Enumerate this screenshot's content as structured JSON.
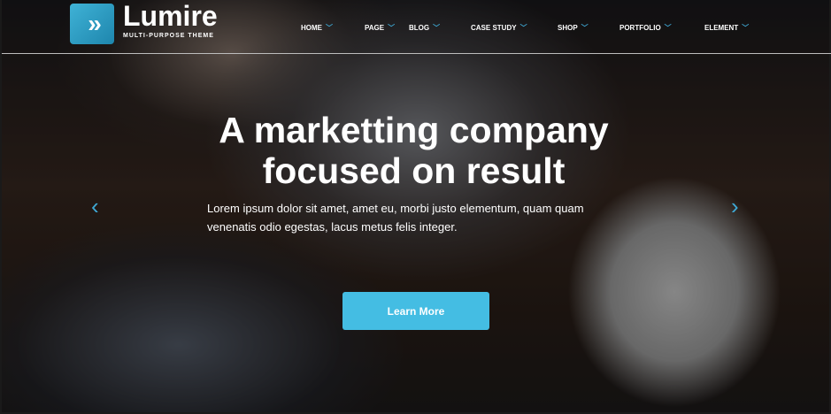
{
  "brand": {
    "name": "Lumire",
    "tagline": "MULTI-PURPOSE THEME",
    "icon": "double-chevron-right-icon"
  },
  "nav": [
    {
      "label": "HOME"
    },
    {
      "label": "PAGE"
    },
    {
      "label": "BLOG"
    },
    {
      "label": "CASE STUDY"
    },
    {
      "label": "SHOP"
    },
    {
      "label": "PORTFOLIO"
    },
    {
      "label": "ELEMENT"
    }
  ],
  "hero": {
    "title_line1": "A marketting company",
    "title_line2": "focused on result",
    "description": "Lorem ipsum dolor sit amet, amet eu, morbi justo elementum, quam quam venenatis odio egestas, lacus metus felis integer.",
    "button": "Learn More",
    "prev_icon": "‹",
    "next_icon": "›"
  },
  "colors": {
    "accent": "#44bde3"
  }
}
